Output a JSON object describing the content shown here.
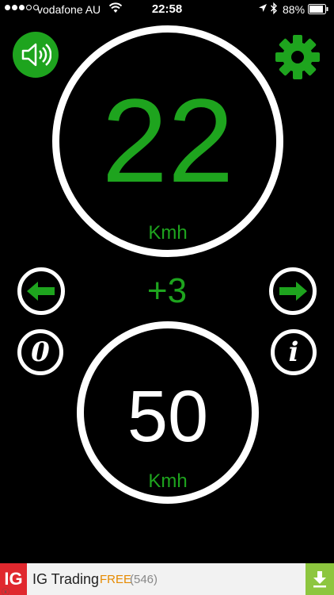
{
  "status_bar": {
    "carrier": "vodafone AU",
    "time": "22:58",
    "battery": "88%",
    "signal_bars_filled": 3,
    "signal_bars_total": 5
  },
  "speed": {
    "value": "22",
    "unit": "Kmh"
  },
  "offset": "+3",
  "limit": {
    "value": "50",
    "unit": "Kmh"
  },
  "buttons": {
    "zero_label": "0",
    "info_label": "i"
  },
  "ad": {
    "logo": "IG",
    "title": "IG Trading",
    "price": "FREE",
    "count": "(546)",
    "close": "ⓧ"
  },
  "colors": {
    "accent": "#1ea41e",
    "background": "#000000",
    "ring": "#ffffff",
    "ad_logo": "#e0282e",
    "ad_download": "#8dc63f",
    "ad_price": "#e68a00"
  },
  "icons": {
    "sound": "speaker-icon",
    "settings": "gear-icon",
    "left": "arrow-left-icon",
    "right": "arrow-right-icon",
    "zero": "zero-icon",
    "info": "info-icon",
    "download": "download-icon"
  }
}
